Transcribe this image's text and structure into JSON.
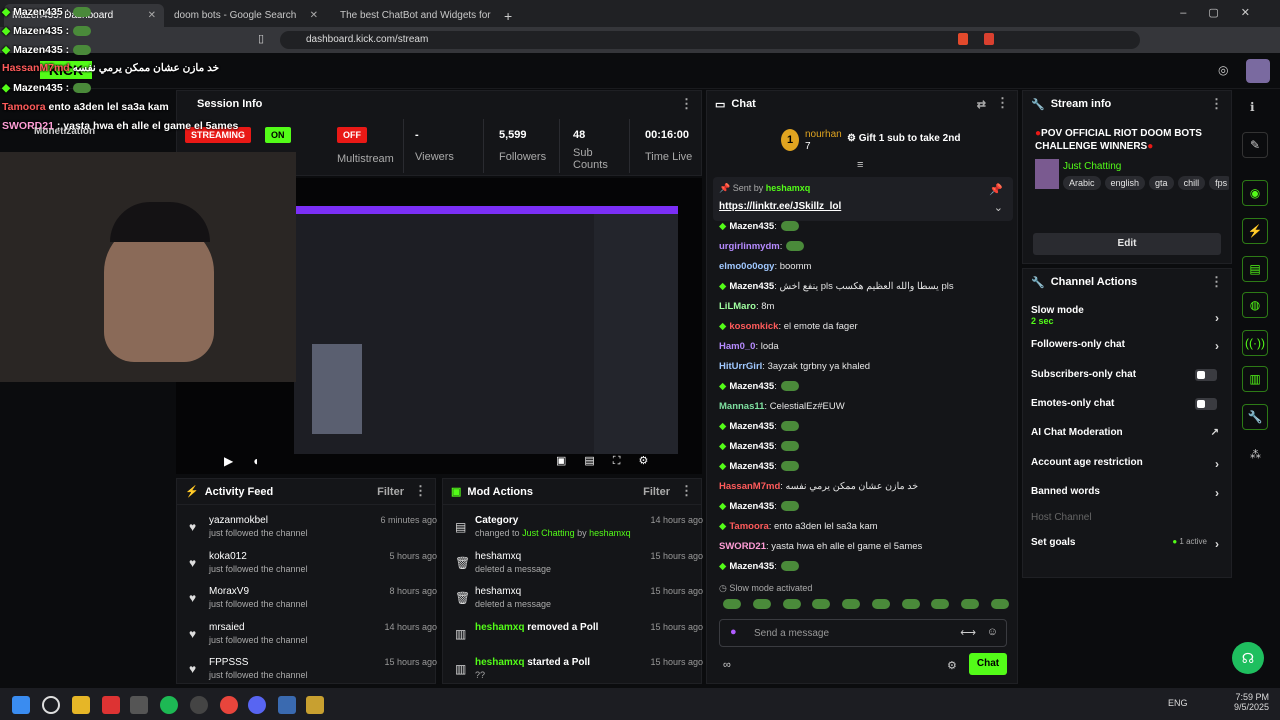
{
  "browser": {
    "tabs": [
      {
        "label": "Mazen435: Dashboard"
      },
      {
        "label": "doom bots - Google Search"
      },
      {
        "label": "The best ChatBot and Widgets for Kick"
      }
    ],
    "url": "dashboard.kick.com/stream"
  },
  "overlay_chat": [
    {
      "text": "Mazen435 :"
    },
    {
      "text": "Mazen435 :"
    },
    {
      "user": "HassanM7md",
      "text": "خد مازن عشان ممكن يرمي نفسه"
    },
    {
      "text": "Mazen435 :"
    },
    {
      "user": "Tamoora",
      "text": "ento a3den lel sa3a kam"
    },
    {
      "user": "SWORD21",
      "text": ": yasta hwa eh alle el game el 5ames"
    }
  ],
  "session": {
    "title": "Session Info",
    "monetization": "Monetization",
    "streaming_badge": "STREAMING",
    "on_badge": "ON",
    "off_badge": "OFF",
    "multistream": "Multistream",
    "viewers_value": "-",
    "viewers_label": "Viewers",
    "followers_value": "5,599",
    "followers_label": "Followers",
    "subs_value": "48",
    "subs_label": "Sub Counts",
    "time_value": "00:16:00",
    "time_label": "Time Live"
  },
  "activity": {
    "title": "Activity Feed",
    "filter": "Filter",
    "items": [
      {
        "name": "yazanmokbel",
        "sub": "just followed the channel",
        "time": "6 minutes ago"
      },
      {
        "name": "koka012",
        "sub": "just followed the channel",
        "time": "5 hours ago"
      },
      {
        "name": "MoraxV9",
        "sub": "just followed the channel",
        "time": "8 hours ago"
      },
      {
        "name": "mrsaied",
        "sub": "just followed the channel",
        "time": "14 hours ago"
      },
      {
        "name": "FPPSSS",
        "sub": "just followed the channel",
        "time": "15 hours ago"
      }
    ]
  },
  "mod": {
    "title": "Mod Actions",
    "filter": "Filter",
    "items": [
      {
        "name": "Category",
        "sub": "changed to",
        "category": "Just Chatting",
        "by": "by",
        "user": "heshamxq",
        "time": "14 hours ago"
      },
      {
        "name": "heshamxq",
        "sub": "deleted a message",
        "time": "15 hours ago"
      },
      {
        "name": "heshamxq",
        "sub": "deleted a message",
        "time": "15 hours ago"
      },
      {
        "user": "heshamxq",
        "name": "removed a Poll",
        "time": "15 hours ago"
      },
      {
        "user": "heshamxq",
        "name": "started a Poll",
        "time": "15 hours ago",
        "sub": "??"
      }
    ]
  },
  "chat": {
    "title": "Chat",
    "top_user": "nourhan",
    "top_count": "7",
    "top_rank": "1",
    "gift_text": "Gift 1 sub to take 2nd",
    "pinned_by_label": "Sent by",
    "pinned_by_user": "heshamxq",
    "pinned_link": "https://linktr.ee/JSkillz_lol",
    "messages": [
      {
        "user": "Mazen435",
        "text": ":",
        "color": "#ffffff",
        "gem": true,
        "emote": true
      },
      {
        "user": "urgirlinmydm",
        "text": ":",
        "color": "#b68bff",
        "emote": true
      },
      {
        "user": "elmo0o0ogy",
        "text": ": boomm",
        "color": "#a0c8ff"
      },
      {
        "user": "Mazen435",
        "text": ": ينفع اخش pls يسطا والله العظيم هكسب pls",
        "color": "#ffffff",
        "gem": true
      },
      {
        "user": "LiLMaro",
        "text": ": 8m",
        "color": "#a0ffa0"
      },
      {
        "user": "kosomkick",
        "text": ": el emote da fager",
        "color": "#ff5b5b",
        "gem": true
      },
      {
        "user": "Ham0_0",
        "text": ": loda",
        "color": "#b68bff"
      },
      {
        "user": "HitUrrGirl",
        "text": ": 3ayzak tgrbny ya khaled",
        "color": "#a0c8ff"
      },
      {
        "user": "Mazen435",
        "text": ":",
        "color": "#ffffff",
        "gem": true,
        "emote": true
      },
      {
        "user": "Mannas11",
        "text": ": CelestialEz#EUW",
        "color": "#7fe0a0"
      },
      {
        "user": "Mazen435",
        "text": ":",
        "color": "#ffffff",
        "gem": true,
        "emote": true
      },
      {
        "user": "Mazen435",
        "text": ":",
        "color": "#ffffff",
        "gem": true,
        "emote": true
      },
      {
        "user": "Mazen435",
        "text": ":",
        "color": "#ffffff",
        "gem": true,
        "emote": true
      },
      {
        "user": "HassanM7md",
        "text": ": خد مازن عشان ممكن يرمي نفسه",
        "color": "#ff5b5b"
      },
      {
        "user": "Mazen435",
        "text": ":",
        "color": "#ffffff",
        "gem": true,
        "emote": true
      },
      {
        "user": "Tamoora",
        "text": ": ento a3den lel sa3a kam",
        "color": "#ff5b5b",
        "gem": true
      },
      {
        "user": "SWORD21",
        "text": ": yasta hwa eh alle el game el 5ames",
        "color": "#ff9dd6"
      },
      {
        "user": "Mazen435",
        "text": ":",
        "color": "#ffffff",
        "gem": true,
        "emote": true
      }
    ],
    "slow_mode_note": "Slow mode activated",
    "input_placeholder": "Send a message",
    "send_label": "Chat"
  },
  "stream_info": {
    "title": "Stream info",
    "stream_title": "POV OFFICIAL RIOT DOOM BOTS CHALLENGE WINNERS",
    "category": "Just Chatting",
    "tags": [
      "Arabic",
      "english",
      "gta",
      "chill",
      "fps"
    ],
    "edit_label": "Edit"
  },
  "channel_actions": {
    "title": "Channel Actions",
    "slow_mode": "Slow mode",
    "slow_mode_value": "2 sec",
    "followers_only": "Followers-only chat",
    "subscribers_only": "Subscribers-only chat",
    "emotes_only": "Emotes-only chat",
    "ai_moderation": "AI Chat Moderation",
    "account_age": "Account age restriction",
    "banned_words": "Banned words",
    "host_channel": "Host Channel",
    "set_goals": "Set goals",
    "goals_active": "1 active"
  },
  "taskbar": {
    "lang": "ENG",
    "time": "7:59 PM",
    "date": "9/5/2025"
  },
  "colors": {
    "kick_green": "#53fc18",
    "live_red": "#e91916",
    "panel_bg": "#141518"
  }
}
